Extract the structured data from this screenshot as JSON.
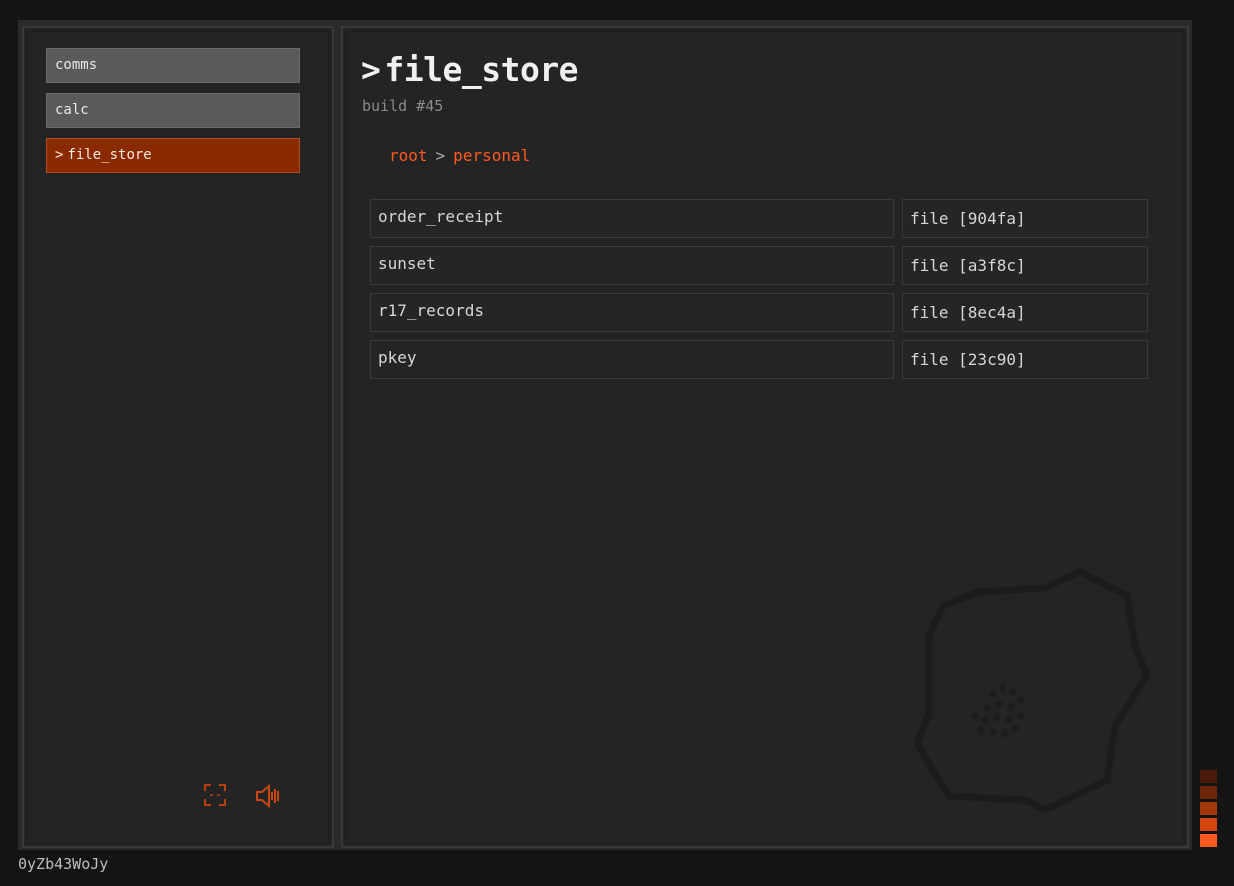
{
  "sidebar": {
    "items": [
      {
        "label": "comms",
        "active": false
      },
      {
        "label": "calc",
        "active": false
      },
      {
        "label": "file_store",
        "active": true
      }
    ],
    "caret": ">",
    "icons": [
      "fullscreen-icon",
      "volume-icon"
    ]
  },
  "main": {
    "caret": ">",
    "title": "file_store",
    "build": "build #45",
    "breadcrumb": {
      "items": [
        "root",
        "personal"
      ],
      "separator": ">"
    },
    "files": [
      {
        "name": "order_receipt",
        "type": "file [904fa]"
      },
      {
        "name": "sunset",
        "type": "file [a3f8c]"
      },
      {
        "name": "r17_records",
        "type": "file [8ec4a]"
      },
      {
        "name": "pkey",
        "type": "file [23c90]"
      }
    ]
  },
  "footer": {
    "id": "0yZb43WoJy"
  },
  "colors": {
    "accent": "#ff5a1e",
    "active_nav": "#8a2a00",
    "meter": [
      "#4a1a08",
      "#6e260a",
      "#a3380c",
      "#d4460f",
      "#ff5a1e"
    ]
  }
}
